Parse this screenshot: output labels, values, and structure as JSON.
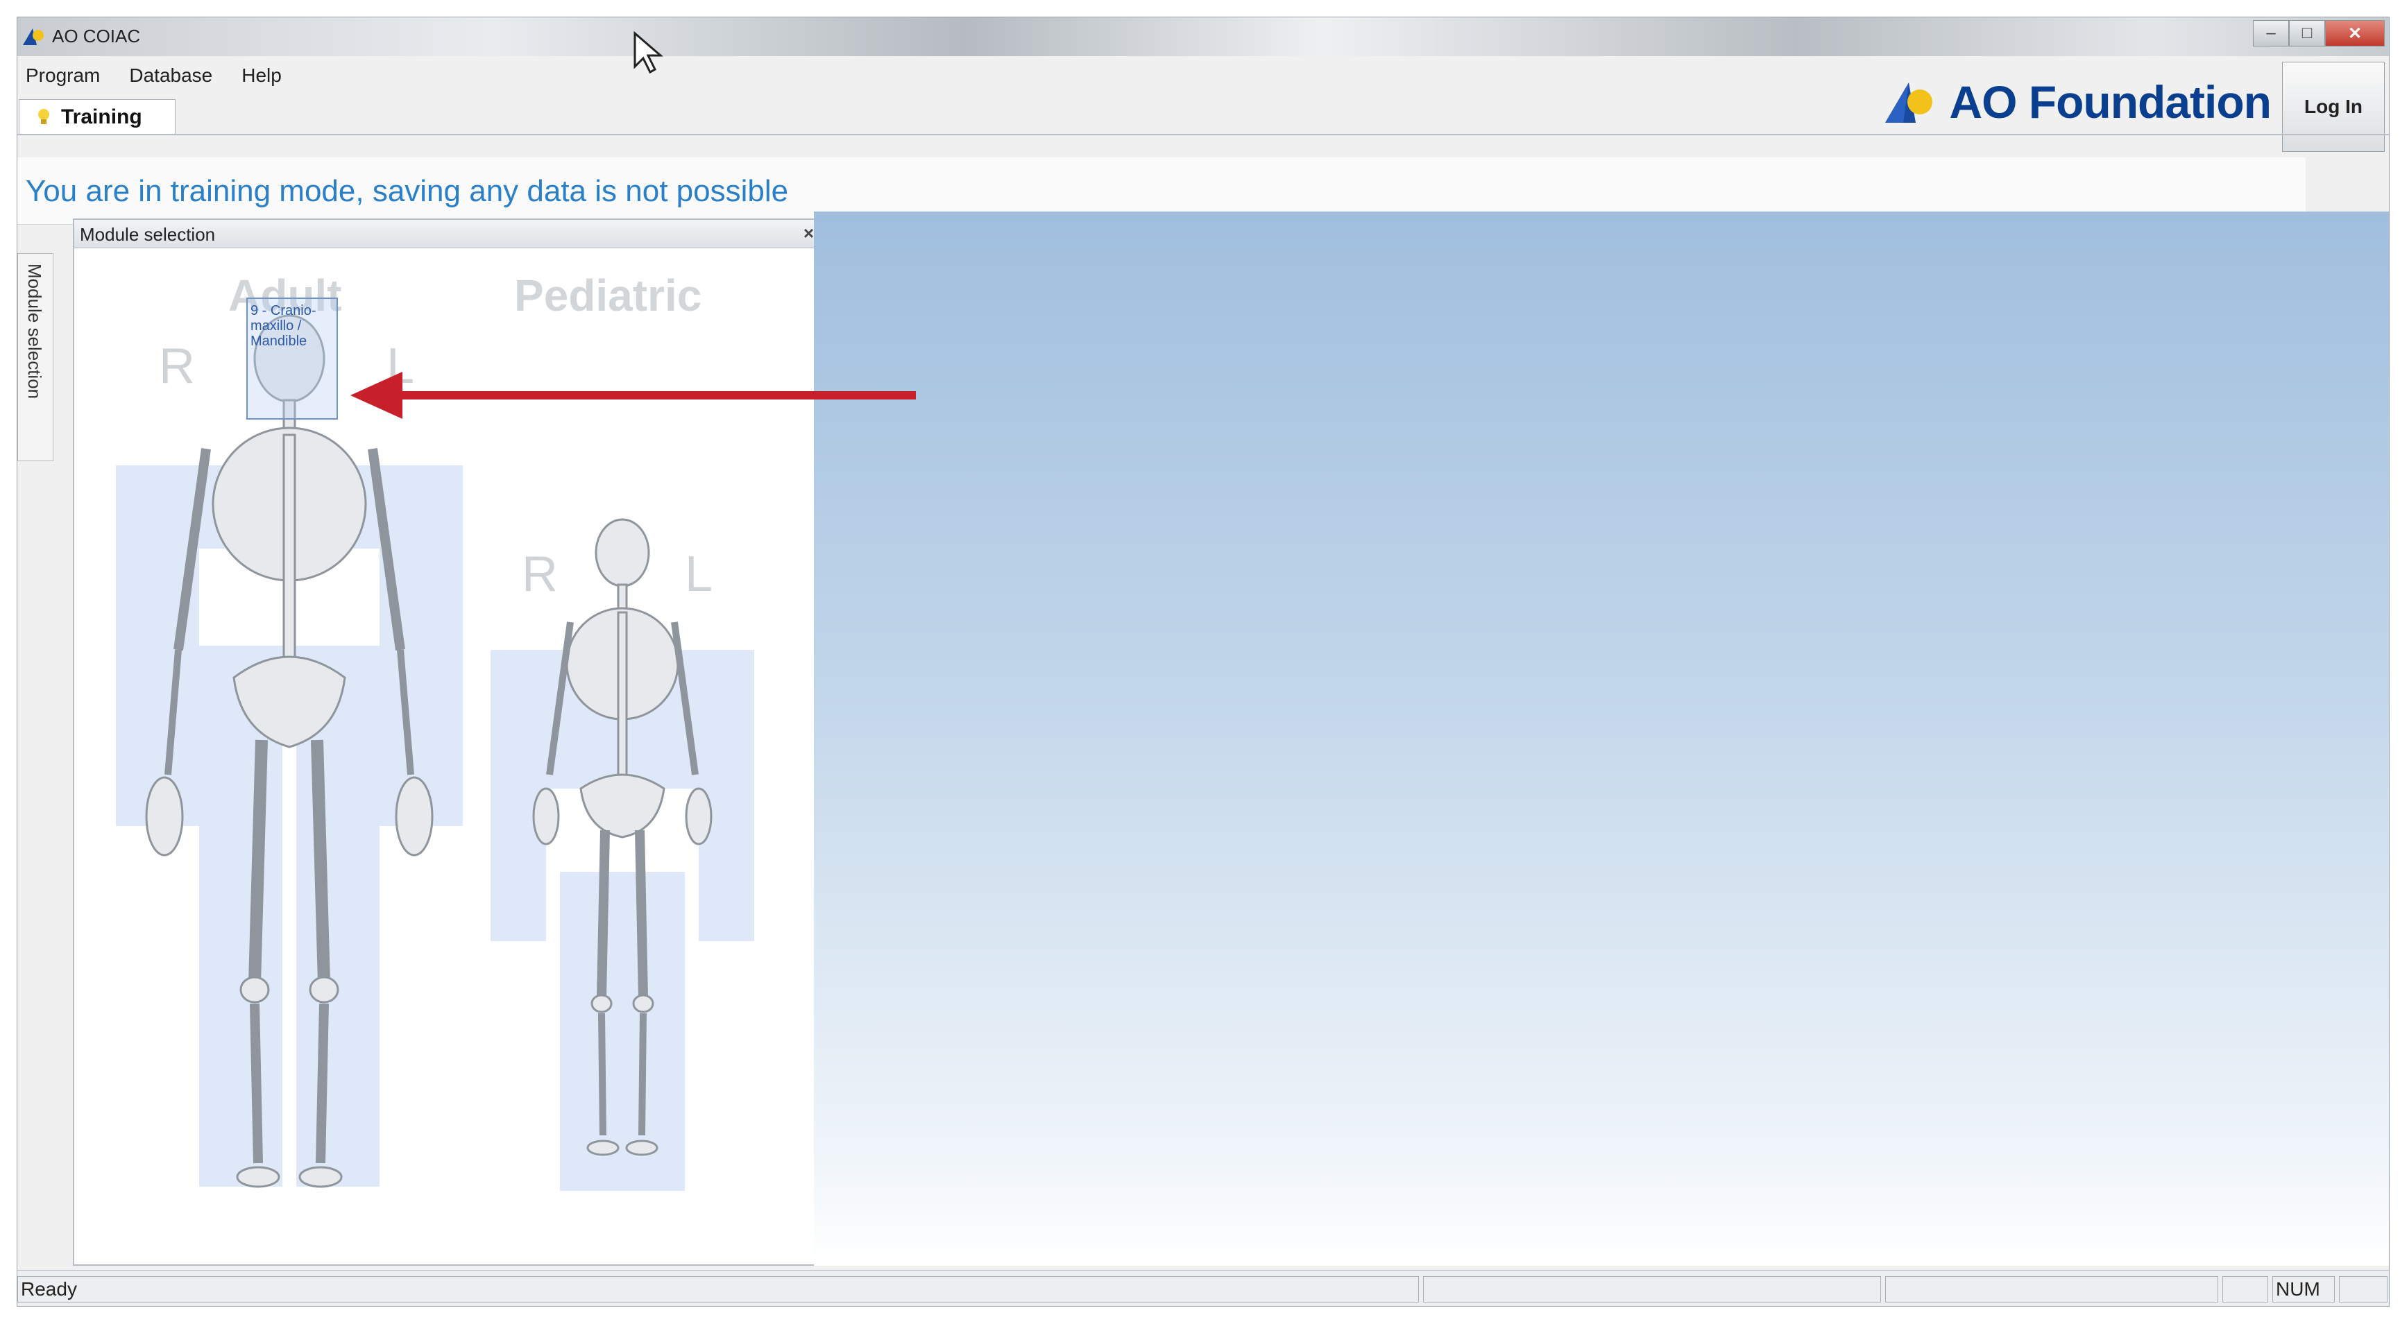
{
  "window": {
    "title": "AO COIAC",
    "controls": {
      "minimize": "–",
      "maximize": "□",
      "close": "✕"
    }
  },
  "menu": {
    "items": [
      "Program",
      "Database",
      "Help"
    ]
  },
  "tab": {
    "label": "Training",
    "icon": "lightbulb-icon"
  },
  "brand": {
    "logo_text": "AO Foundation",
    "color": "#0a3f8f"
  },
  "login": {
    "label": "Log In"
  },
  "banner": {
    "message": "You are in training mode, saving any data is not possible",
    "color": "#2a7fc9"
  },
  "sidebar": {
    "vertical_tab_label": "Module selection"
  },
  "module_panel": {
    "title": "Module selection",
    "close": "×",
    "categories": {
      "adult": "Adult",
      "pediatric": "Pediatric"
    },
    "adult_sides": {
      "right": "R",
      "left": "L"
    },
    "pediatric_sides": {
      "right": "R",
      "left": "L"
    },
    "selected_module_label": "9 - Cranio-maxillo / Mandible"
  },
  "status": {
    "ready": "Ready",
    "num": "NUM"
  },
  "annotation": {
    "arrow_color": "#c8202a"
  }
}
